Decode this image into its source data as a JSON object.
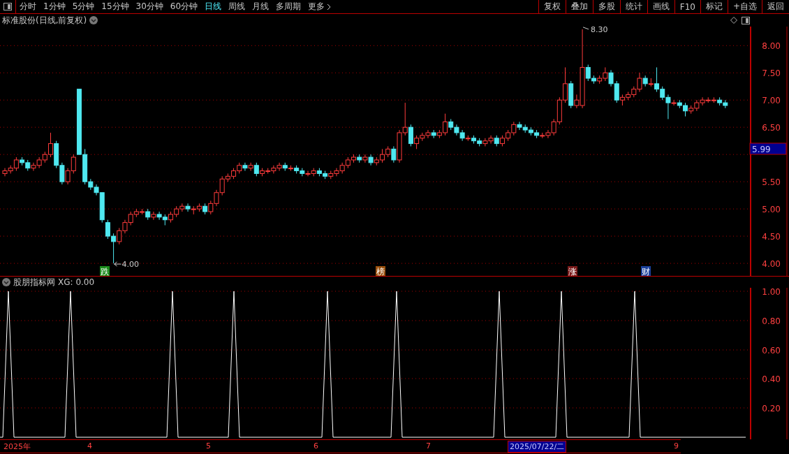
{
  "toolbar": {
    "periods": [
      {
        "label": "分时",
        "selected": false
      },
      {
        "label": "1分钟",
        "selected": false
      },
      {
        "label": "5分钟",
        "selected": false
      },
      {
        "label": "15分钟",
        "selected": false
      },
      {
        "label": "30分钟",
        "selected": false
      },
      {
        "label": "60分钟",
        "selected": false
      },
      {
        "label": "日线",
        "selected": true
      },
      {
        "label": "周线",
        "selected": false
      },
      {
        "label": "月线",
        "selected": false
      },
      {
        "label": "多周期",
        "selected": false
      }
    ],
    "more": "更多",
    "actions": [
      "复权",
      "叠加",
      "多股",
      "统计",
      "画线",
      "F10",
      "标记",
      "+自选",
      "返回"
    ]
  },
  "main_chart": {
    "title": "标准股份(日线,前复权)",
    "chart_data": {
      "type": "candlestick",
      "categories": [
        null,
        null,
        null,
        null,
        null,
        null,
        null,
        null,
        null,
        null,
        null,
        null,
        null,
        null,
        null,
        null,
        null,
        null,
        null,
        null,
        null,
        null,
        null,
        null,
        null,
        null,
        null,
        null,
        null,
        null,
        null,
        null,
        null,
        null,
        null,
        null,
        null,
        null,
        null,
        null,
        null,
        null,
        null,
        null,
        null,
        null,
        null,
        null,
        null,
        null,
        null,
        null,
        null,
        null,
        null,
        null,
        null,
        null,
        null,
        null,
        null,
        null,
        null,
        null,
        null,
        null,
        null,
        null,
        null,
        null,
        null,
        null,
        null,
        null,
        null,
        null,
        null,
        null,
        null,
        null,
        null,
        null,
        null,
        null,
        null,
        null,
        null,
        null,
        null,
        null,
        null,
        null,
        null,
        null,
        null,
        null,
        null,
        null,
        null,
        null,
        null,
        null,
        null,
        null,
        null,
        null,
        null,
        null,
        null,
        null,
        null,
        null,
        null,
        null,
        null,
        null,
        null,
        null,
        null,
        null,
        null,
        null,
        null,
        null,
        null,
        null,
        null
      ],
      "ylim": [
        3.77,
        8.35
      ],
      "yticks": [
        {
          "value": 8,
          "label": "8.00"
        },
        {
          "value": 7.5,
          "label": "7.50"
        },
        {
          "value": 7,
          "label": "7.00"
        },
        {
          "value": 6.5,
          "label": "6.50"
        },
        {
          "value": 5.5,
          "label": "5.50"
        },
        {
          "value": 5,
          "label": "5.00"
        },
        {
          "value": 4.5,
          "label": "4.50"
        },
        {
          "value": 4,
          "label": "4.00"
        }
      ],
      "ohlc": [
        [
          5.65,
          5.75,
          5.6,
          5.7
        ],
        [
          5.7,
          5.8,
          5.65,
          5.75
        ],
        [
          5.75,
          5.95,
          5.7,
          5.9
        ],
        [
          5.9,
          5.95,
          5.8,
          5.85
        ],
        [
          5.85,
          5.9,
          5.7,
          5.75
        ],
        [
          5.75,
          5.85,
          5.7,
          5.8
        ],
        [
          5.8,
          5.95,
          5.75,
          5.9
        ],
        [
          5.9,
          6.05,
          5.85,
          6.0
        ],
        [
          6.0,
          6.4,
          5.95,
          6.2
        ],
        [
          6.2,
          6.25,
          5.75,
          5.8
        ],
        [
          5.8,
          5.85,
          5.45,
          5.5
        ],
        [
          5.5,
          5.75,
          5.45,
          5.7
        ],
        [
          5.7,
          6.0,
          5.65,
          5.95
        ],
        [
          7.2,
          7.2,
          6.0,
          6.0
        ],
        [
          6.0,
          6.1,
          5.45,
          5.5
        ],
        [
          5.5,
          5.55,
          5.35,
          5.4
        ],
        [
          5.4,
          5.45,
          5.25,
          5.3
        ],
        [
          5.3,
          5.3,
          4.75,
          4.8
        ],
        [
          4.75,
          4.8,
          4.45,
          4.5
        ],
        [
          4.5,
          4.55,
          4.0,
          4.4
        ],
        [
          4.4,
          4.65,
          4.35,
          4.6
        ],
        [
          4.6,
          4.8,
          4.55,
          4.75
        ],
        [
          4.75,
          4.95,
          4.7,
          4.9
        ],
        [
          4.9,
          5.0,
          4.85,
          4.95
        ],
        [
          4.95,
          5.0,
          4.9,
          4.95
        ],
        [
          4.95,
          5.0,
          4.8,
          4.85
        ],
        [
          4.85,
          4.95,
          4.8,
          4.9
        ],
        [
          4.9,
          4.95,
          4.8,
          4.85
        ],
        [
          4.85,
          4.9,
          4.7,
          4.8
        ],
        [
          4.8,
          4.95,
          4.75,
          4.9
        ],
        [
          4.9,
          5.05,
          4.85,
          5.0
        ],
        [
          5.0,
          5.1,
          4.95,
          5.05
        ],
        [
          5.05,
          5.1,
          4.95,
          5.0
        ],
        [
          5.0,
          5.05,
          4.9,
          5.0
        ],
        [
          5.0,
          5.1,
          4.95,
          5.05
        ],
        [
          5.05,
          5.1,
          4.9,
          4.95
        ],
        [
          4.95,
          5.15,
          4.9,
          5.1
        ],
        [
          5.1,
          5.35,
          5.05,
          5.3
        ],
        [
          5.3,
          5.6,
          5.25,
          5.55
        ],
        [
          5.55,
          5.65,
          5.5,
          5.6
        ],
        [
          5.6,
          5.75,
          5.55,
          5.7
        ],
        [
          5.7,
          5.85,
          5.65,
          5.8
        ],
        [
          5.8,
          5.85,
          5.7,
          5.75
        ],
        [
          5.75,
          5.85,
          5.7,
          5.8
        ],
        [
          5.8,
          5.85,
          5.6,
          5.65
        ],
        [
          5.65,
          5.75,
          5.6,
          5.7
        ],
        [
          5.7,
          5.75,
          5.65,
          5.7
        ],
        [
          5.7,
          5.8,
          5.65,
          5.75
        ],
        [
          5.75,
          5.85,
          5.7,
          5.8
        ],
        [
          5.8,
          5.85,
          5.7,
          5.75
        ],
        [
          5.75,
          5.8,
          5.7,
          5.75
        ],
        [
          5.75,
          5.8,
          5.65,
          5.7
        ],
        [
          5.7,
          5.75,
          5.6,
          5.65
        ],
        [
          5.65,
          5.7,
          5.6,
          5.65
        ],
        [
          5.65,
          5.75,
          5.6,
          5.7
        ],
        [
          5.7,
          5.75,
          5.6,
          5.65
        ],
        [
          5.65,
          5.7,
          5.55,
          5.6
        ],
        [
          5.6,
          5.7,
          5.55,
          5.65
        ],
        [
          5.65,
          5.75,
          5.6,
          5.7
        ],
        [
          5.7,
          5.85,
          5.65,
          5.8
        ],
        [
          5.8,
          5.95,
          5.75,
          5.9
        ],
        [
          5.9,
          6.0,
          5.85,
          5.95
        ],
        [
          5.95,
          6.0,
          5.85,
          5.9
        ],
        [
          5.9,
          6.0,
          5.85,
          5.95
        ],
        [
          5.95,
          6.0,
          5.8,
          5.85
        ],
        [
          5.85,
          5.95,
          5.8,
          5.9
        ],
        [
          5.9,
          6.1,
          5.85,
          6.0
        ],
        [
          6.0,
          6.15,
          5.95,
          6.1
        ],
        [
          6.1,
          6.15,
          5.85,
          5.9
        ],
        [
          5.9,
          6.45,
          5.85,
          6.4
        ],
        [
          6.4,
          6.95,
          6.35,
          6.5
        ],
        [
          6.5,
          6.55,
          6.15,
          6.2
        ],
        [
          6.2,
          6.35,
          6.1,
          6.3
        ],
        [
          6.3,
          6.4,
          6.25,
          6.35
        ],
        [
          6.35,
          6.45,
          6.3,
          6.4
        ],
        [
          6.4,
          6.45,
          6.3,
          6.35
        ],
        [
          6.35,
          6.45,
          6.3,
          6.4
        ],
        [
          6.4,
          6.75,
          6.35,
          6.6
        ],
        [
          6.6,
          6.65,
          6.45,
          6.5
        ],
        [
          6.5,
          6.55,
          6.35,
          6.4
        ],
        [
          6.4,
          6.45,
          6.25,
          6.3
        ],
        [
          6.3,
          6.35,
          6.25,
          6.3
        ],
        [
          6.3,
          6.35,
          6.2,
          6.25
        ],
        [
          6.25,
          6.3,
          6.15,
          6.2
        ],
        [
          6.2,
          6.3,
          6.15,
          6.25
        ],
        [
          6.25,
          6.35,
          6.2,
          6.3
        ],
        [
          6.3,
          6.35,
          6.15,
          6.2
        ],
        [
          6.2,
          6.35,
          6.15,
          6.3
        ],
        [
          6.3,
          6.45,
          6.25,
          6.4
        ],
        [
          6.4,
          6.6,
          6.35,
          6.55
        ],
        [
          6.55,
          6.6,
          6.45,
          6.5
        ],
        [
          6.5,
          6.55,
          6.4,
          6.45
        ],
        [
          6.45,
          6.5,
          6.35,
          6.4
        ],
        [
          6.4,
          6.45,
          6.3,
          6.35
        ],
        [
          6.35,
          6.4,
          6.3,
          6.35
        ],
        [
          6.35,
          6.45,
          6.3,
          6.4
        ],
        [
          6.4,
          6.65,
          6.35,
          6.6
        ],
        [
          6.6,
          7.05,
          6.55,
          7.0
        ],
        [
          7.0,
          7.6,
          6.95,
          7.3
        ],
        [
          7.3,
          7.35,
          6.85,
          6.9
        ],
        [
          6.9,
          7.1,
          6.85,
          7.0
        ],
        [
          6.9,
          8.3,
          6.85,
          7.6
        ],
        [
          7.6,
          7.65,
          7.35,
          7.4
        ],
        [
          7.4,
          7.45,
          7.3,
          7.35
        ],
        [
          7.35,
          7.45,
          7.3,
          7.4
        ],
        [
          7.4,
          7.6,
          7.35,
          7.5
        ],
        [
          7.5,
          7.55,
          7.25,
          7.3
        ],
        [
          7.3,
          7.35,
          6.95,
          7.0
        ],
        [
          7.0,
          7.1,
          6.9,
          7.05
        ],
        [
          7.05,
          7.15,
          7.0,
          7.1
        ],
        [
          7.1,
          7.25,
          7.05,
          7.2
        ],
        [
          7.2,
          7.5,
          7.15,
          7.4
        ],
        [
          7.4,
          7.45,
          7.25,
          7.3
        ],
        [
          7.3,
          7.4,
          7.25,
          7.3
        ],
        [
          7.3,
          7.6,
          7.15,
          7.2
        ],
        [
          7.2,
          7.25,
          7.0,
          7.05
        ],
        [
          7.05,
          7.1,
          6.65,
          6.95
        ],
        [
          6.95,
          7.0,
          6.9,
          6.95
        ],
        [
          6.95,
          7.0,
          6.85,
          6.9
        ],
        [
          6.9,
          6.95,
          6.7,
          6.8
        ],
        [
          6.8,
          6.9,
          6.75,
          6.85
        ],
        [
          6.85,
          7.0,
          6.8,
          6.95
        ],
        [
          6.95,
          7.05,
          6.9,
          7.0
        ],
        [
          7.0,
          7.05,
          6.95,
          7.0
        ],
        [
          7.0,
          7.05,
          6.95,
          7.0
        ],
        [
          7.0,
          7.05,
          6.9,
          6.95
        ],
        [
          6.95,
          7.0,
          6.85,
          6.9
        ]
      ]
    },
    "current_price": "5.99",
    "high_mark": "8.30",
    "low_mark": "4.00",
    "badges": [
      {
        "label": "跌",
        "color": "#1a8a1a"
      },
      {
        "label": "榜",
        "color": "#9a4f0c"
      },
      {
        "label": "涨",
        "color": "#7a1a1a"
      },
      {
        "label": "财",
        "color": "#1a3f9a"
      }
    ]
  },
  "indicator": {
    "title": "股朋指标网",
    "readout": "XG: 0.00",
    "axis": [
      "1.00",
      "0.80",
      "0.60",
      "0.40",
      "0.20"
    ]
  },
  "time_axis": {
    "labels": [
      "2025年",
      "4",
      "5",
      "6",
      "7",
      "9"
    ],
    "cursor_date": "2025/07/22/二"
  }
}
